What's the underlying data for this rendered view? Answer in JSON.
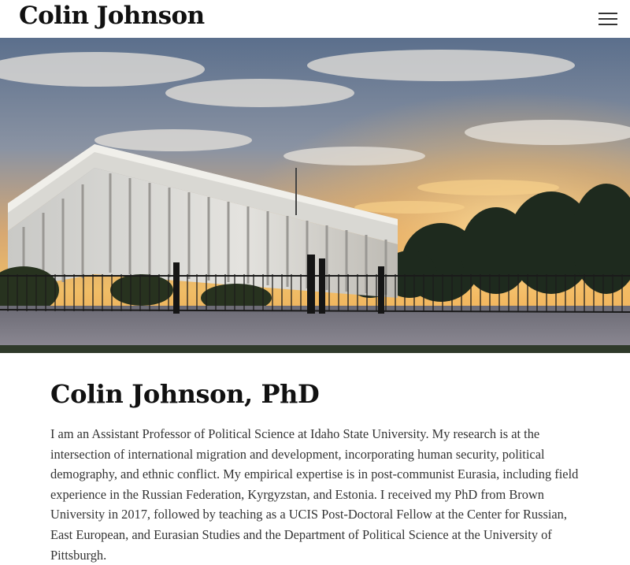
{
  "header": {
    "site_title": "Colin Johnson",
    "menu_icon": "hamburger-menu-icon"
  },
  "hero": {
    "image": "sunset-government-building-photo"
  },
  "main": {
    "heading": "Colin Johnson, PhD",
    "bio": "I am an Assistant Professor of Political Science at Idaho State University. My research is at the intersection of international migration and development, incorporating human security, political demography, and ethnic conflict. My empirical expertise is in post-communist Eurasia, including field experience in the Russian Federation, Kyrgyzstan, and Estonia. I received my PhD from Brown University in 2017, followed by teaching as a UCIS Post-Doctoral Fellow at the Center for Russian, East European, and Eurasian Studies and the Department of Political Science at the University of Pittsburgh."
  },
  "colors": {
    "title": "#111111",
    "body_text": "#333333",
    "sky_top": "#5f7590",
    "sky_glow": "#f2b45a",
    "building": "#dcdcd8",
    "trees": "#1f2a1d"
  }
}
